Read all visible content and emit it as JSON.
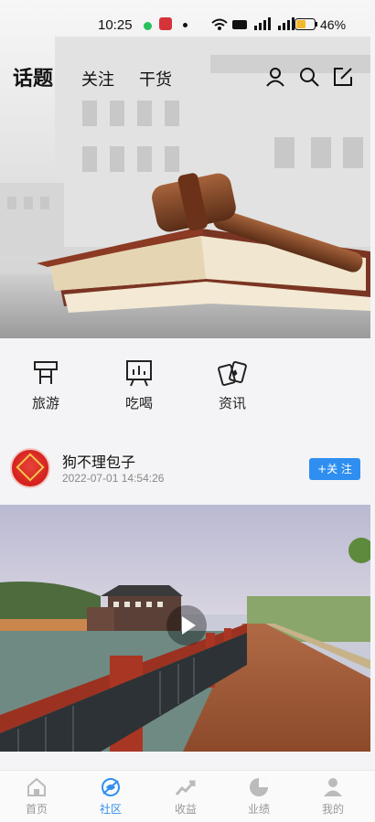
{
  "status_bar": {
    "time": "10:25",
    "battery": "46%"
  },
  "top_nav": {
    "tabs": [
      {
        "label": "话题"
      },
      {
        "label": "关注"
      },
      {
        "label": "干货"
      }
    ]
  },
  "icons": {
    "profile": "user-icon",
    "search": "search-icon",
    "compose": "edit-icon"
  },
  "categories": [
    {
      "label": "旅游",
      "icon": "travel-icon"
    },
    {
      "label": "吃喝",
      "icon": "food-board-icon"
    },
    {
      "label": "资讯",
      "icon": "cards-icon"
    }
  ],
  "post": {
    "username": "狗不理包子",
    "timestamp": "2022-07-01 14:54:26",
    "follow_label": "+关 注"
  },
  "bottom_nav": [
    {
      "label": "首页",
      "icon": "home-icon"
    },
    {
      "label": "社区",
      "icon": "community-icon"
    },
    {
      "label": "收益",
      "icon": "earnings-icon"
    },
    {
      "label": "业绩",
      "icon": "performance-icon"
    },
    {
      "label": "我的",
      "icon": "me-icon"
    }
  ],
  "colors": {
    "accent": "#2f8ff0",
    "inactive": "#999999"
  }
}
